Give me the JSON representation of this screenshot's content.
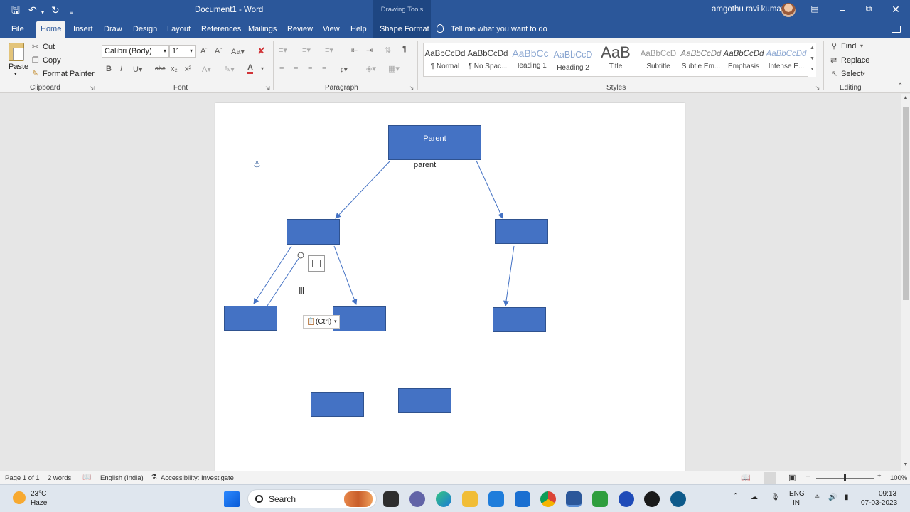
{
  "titlebar": {
    "doc_title": "Document1  -  Word",
    "contextual_tab_group": "Drawing Tools",
    "user_name": "amgothu ravi kumar"
  },
  "tabs": [
    {
      "label": "File"
    },
    {
      "label": "Home"
    },
    {
      "label": "Insert"
    },
    {
      "label": "Draw"
    },
    {
      "label": "Design"
    },
    {
      "label": "Layout"
    },
    {
      "label": "References"
    },
    {
      "label": "Mailings"
    },
    {
      "label": "Review"
    },
    {
      "label": "View"
    },
    {
      "label": "Help"
    },
    {
      "label": "Shape Format"
    }
  ],
  "tell_me": "Tell me what you want to do",
  "clipboard": {
    "paste": "Paste",
    "cut": "Cut",
    "copy": "Copy",
    "format_painter": "Format Painter",
    "label": "Clipboard"
  },
  "font": {
    "family": "Calibri (Body)",
    "size": "11",
    "label": "Font"
  },
  "paragraph": {
    "label": "Paragraph"
  },
  "styles": {
    "label": "Styles",
    "items": [
      {
        "sample": "AaBbCcDd",
        "name": "¶ Normal"
      },
      {
        "sample": "AaBbCcDd",
        "name": "¶ No Spac..."
      },
      {
        "sample": "AaBbCc",
        "name": "Heading 1"
      },
      {
        "sample": "AaBbCcD",
        "name": "Heading 2"
      },
      {
        "sample": "AaB",
        "name": "Title"
      },
      {
        "sample": "AaBbCcD",
        "name": "Subtitle"
      },
      {
        "sample": "AaBbCcDd",
        "name": "Subtle Em..."
      },
      {
        "sample": "AaBbCcDd",
        "name": "Emphasis"
      },
      {
        "sample": "AaBbCcDd",
        "name": "Intense E..."
      }
    ]
  },
  "editing": {
    "find": "Find",
    "replace": "Replace",
    "select": "Select",
    "label": "Editing"
  },
  "document": {
    "parent_shape_text": "Parent",
    "parent_caption": "parent",
    "paste_options": "(Ctrl)"
  },
  "status": {
    "page": "Page 1 of 1",
    "words": "2 words",
    "language": "English (India)",
    "accessibility": "Accessibility: Investigate",
    "zoom": "100%"
  },
  "taskbar": {
    "temperature": "23°C",
    "condition": "Haze",
    "search": "Search",
    "lang_line1": "ENG",
    "lang_line2": "IN",
    "time": "09:13",
    "date": "07-03-2023"
  },
  "colors": {
    "word_blue": "#2b579a",
    "shape_fill": "#4472c4",
    "shape_border": "#2f528f"
  }
}
